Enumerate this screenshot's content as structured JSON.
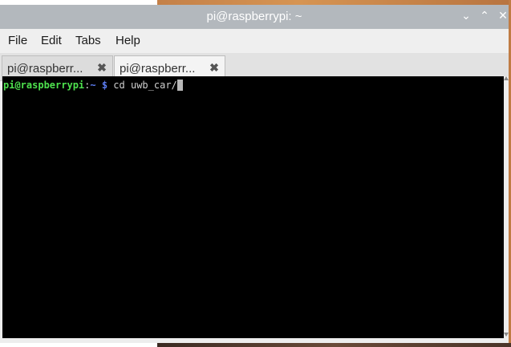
{
  "window": {
    "title": "pi@raspberrypi: ~",
    "controls": {
      "minimize": "⌄",
      "maximize": "⌃",
      "close": "✕"
    }
  },
  "menubar": {
    "items": [
      "File",
      "Edit",
      "Tabs",
      "Help"
    ]
  },
  "tabs": [
    {
      "label": "pi@raspberr...",
      "close": "✖",
      "active": false
    },
    {
      "label": "pi@raspberr...",
      "close": "✖",
      "active": true
    }
  ],
  "terminal": {
    "prompt_user": "pi@raspberrypi",
    "prompt_sep": ":",
    "prompt_path": "~ $",
    "command": " cd uwb_car/",
    "colors": {
      "user": "#4ee24e",
      "path": "#5c7cf0",
      "background": "#000000"
    }
  }
}
